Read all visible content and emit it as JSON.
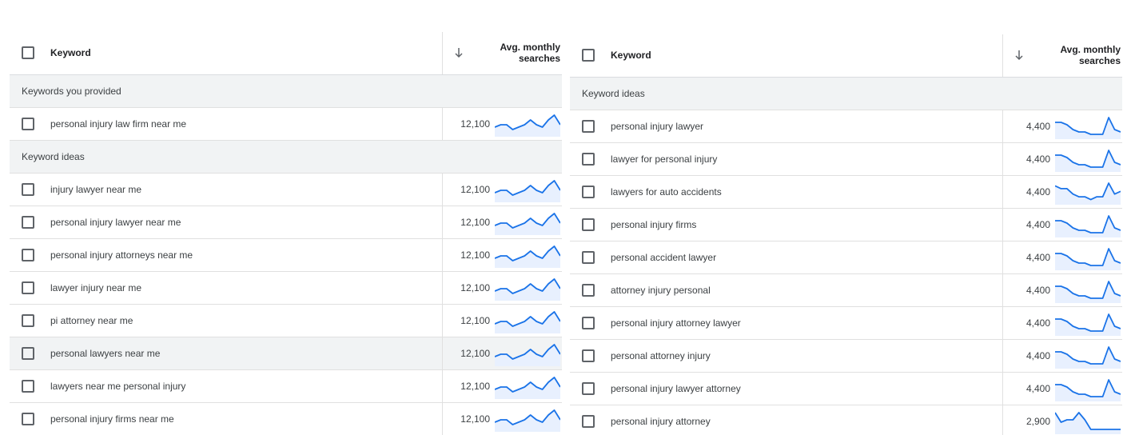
{
  "colors": {
    "trend_line": "#1a73e8",
    "trend_fill": "#e8f0fe",
    "group_bg": "#f1f3f4",
    "hover_bg": "#f1f3f4"
  },
  "left": {
    "header": {
      "keyword_label": "Keyword",
      "sort_icon": "arrow-down-icon",
      "avg_label_line1": "Avg. monthly",
      "avg_label_line2": "searches"
    },
    "sections": [
      {
        "label": "Keywords you provided",
        "rows": [
          {
            "keyword": "personal injury law firm near me",
            "avg": "12,100",
            "trend": [
              3,
              4,
              4,
              2,
              3,
              4,
              6,
              4,
              3,
              6,
              8,
              4
            ]
          }
        ]
      },
      {
        "label": "Keyword ideas",
        "rows": [
          {
            "keyword": "injury lawyer near me",
            "avg": "12,100",
            "trend": [
              3,
              4,
              4,
              2,
              3,
              4,
              6,
              4,
              3,
              6,
              8,
              4
            ]
          },
          {
            "keyword": "personal injury lawyer near me",
            "avg": "12,100",
            "trend": [
              3,
              4,
              4,
              2,
              3,
              4,
              6,
              4,
              3,
              6,
              8,
              4
            ]
          },
          {
            "keyword": "personal injury attorneys near me",
            "avg": "12,100",
            "trend": [
              3,
              4,
              4,
              2,
              3,
              4,
              6,
              4,
              3,
              6,
              8,
              4
            ]
          },
          {
            "keyword": "lawyer injury near me",
            "avg": "12,100",
            "trend": [
              3,
              4,
              4,
              2,
              3,
              4,
              6,
              4,
              3,
              6,
              8,
              4
            ]
          },
          {
            "keyword": "pi attorney near me",
            "avg": "12,100",
            "trend": [
              3,
              4,
              4,
              2,
              3,
              4,
              6,
              4,
              3,
              6,
              8,
              4
            ]
          },
          {
            "keyword": "personal lawyers near me",
            "avg": "12,100",
            "trend": [
              3,
              4,
              4,
              2,
              3,
              4,
              6,
              4,
              3,
              6,
              8,
              4
            ],
            "hover": true
          },
          {
            "keyword": "lawyers near me personal injury",
            "avg": "12,100",
            "trend": [
              3,
              4,
              4,
              2,
              3,
              4,
              6,
              4,
              3,
              6,
              8,
              4
            ]
          },
          {
            "keyword": "personal injury firms near me",
            "avg": "12,100",
            "trend": [
              3,
              4,
              4,
              2,
              3,
              4,
              6,
              4,
              3,
              6,
              8,
              4
            ]
          }
        ]
      }
    ]
  },
  "right": {
    "header": {
      "keyword_label": "Keyword",
      "sort_icon": "arrow-down-icon",
      "avg_label_line1": "Avg. monthly",
      "avg_label_line2": "searches"
    },
    "sections": [
      {
        "label": "Keyword ideas",
        "rows": [
          {
            "keyword": "personal injury lawyer",
            "avg": "4,400",
            "trend": [
              6,
              6,
              5,
              3,
              2,
              2,
              1,
              1,
              1,
              8,
              3,
              2
            ]
          },
          {
            "keyword": "lawyer for personal injury",
            "avg": "4,400",
            "trend": [
              6,
              6,
              5,
              3,
              2,
              2,
              1,
              1,
              1,
              8,
              3,
              2
            ]
          },
          {
            "keyword": "lawyers for auto accidents",
            "avg": "4,400",
            "trend": [
              6,
              5,
              5,
              3,
              2,
              2,
              1,
              2,
              2,
              7,
              3,
              4
            ]
          },
          {
            "keyword": "personal injury firms",
            "avg": "4,400",
            "trend": [
              6,
              6,
              5,
              3,
              2,
              2,
              1,
              1,
              1,
              8,
              3,
              2
            ]
          },
          {
            "keyword": "personal accident lawyer",
            "avg": "4,400",
            "trend": [
              6,
              6,
              5,
              3,
              2,
              2,
              1,
              1,
              1,
              8,
              3,
              2
            ]
          },
          {
            "keyword": "attorney injury personal",
            "avg": "4,400",
            "trend": [
              6,
              6,
              5,
              3,
              2,
              2,
              1,
              1,
              1,
              8,
              3,
              2
            ]
          },
          {
            "keyword": "personal injury attorney lawyer",
            "avg": "4,400",
            "trend": [
              6,
              6,
              5,
              3,
              2,
              2,
              1,
              1,
              1,
              8,
              3,
              2
            ]
          },
          {
            "keyword": "personal attorney injury",
            "avg": "4,400",
            "trend": [
              6,
              6,
              5,
              3,
              2,
              2,
              1,
              1,
              1,
              8,
              3,
              2
            ]
          },
          {
            "keyword": "personal injury lawyer attorney",
            "avg": "4,400",
            "trend": [
              6,
              6,
              5,
              3,
              2,
              2,
              1,
              1,
              1,
              8,
              3,
              2
            ]
          },
          {
            "keyword": "personal injury attorney",
            "avg": "2,900",
            "trend": [
              8,
              4,
              5,
              5,
              8,
              5,
              1,
              1,
              1,
              1,
              1,
              1
            ]
          }
        ]
      }
    ]
  }
}
